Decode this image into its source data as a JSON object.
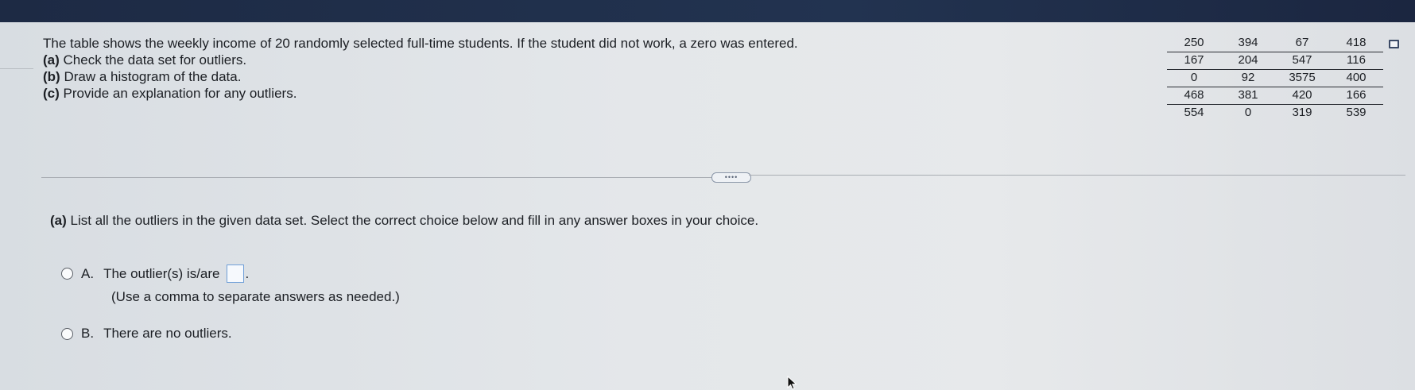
{
  "question": {
    "intro": "The table shows the weekly income of 20 randomly selected full-time students. If the student did not work, a zero was entered.",
    "parts": [
      {
        "label": "(a)",
        "text": "Check the data set for outliers."
      },
      {
        "label": "(b)",
        "text": "Draw a histogram of the data."
      },
      {
        "label": "(c)",
        "text": "Provide an explanation for any outliers."
      }
    ]
  },
  "data_table": {
    "rows": [
      [
        "250",
        "394",
        "67",
        "418"
      ],
      [
        "167",
        "204",
        "547",
        "116"
      ],
      [
        "0",
        "92",
        "3575",
        "400"
      ],
      [
        "468",
        "381",
        "420",
        "166"
      ],
      [
        "554",
        "0",
        "319",
        "539"
      ]
    ]
  },
  "icons": {
    "copy": "copy-data-icon",
    "expand": "ellipsis-icon",
    "cursor": "mouse-pointer-icon"
  },
  "part_a": {
    "label": "(a)",
    "prompt": "List all the outliers in the given data set. Select the correct choice below and fill in any answer boxes in your choice.",
    "choices": [
      {
        "letter": "A.",
        "text": "The outlier(s) is/are",
        "suffix": ".",
        "hint": "(Use a comma to separate answers as needed.)",
        "answer_value": ""
      },
      {
        "letter": "B.",
        "text": "There are no outliers."
      }
    ]
  },
  "colors": {
    "answer_box_border": "#6f9fd8",
    "top_bar": "#1d2a44"
  }
}
